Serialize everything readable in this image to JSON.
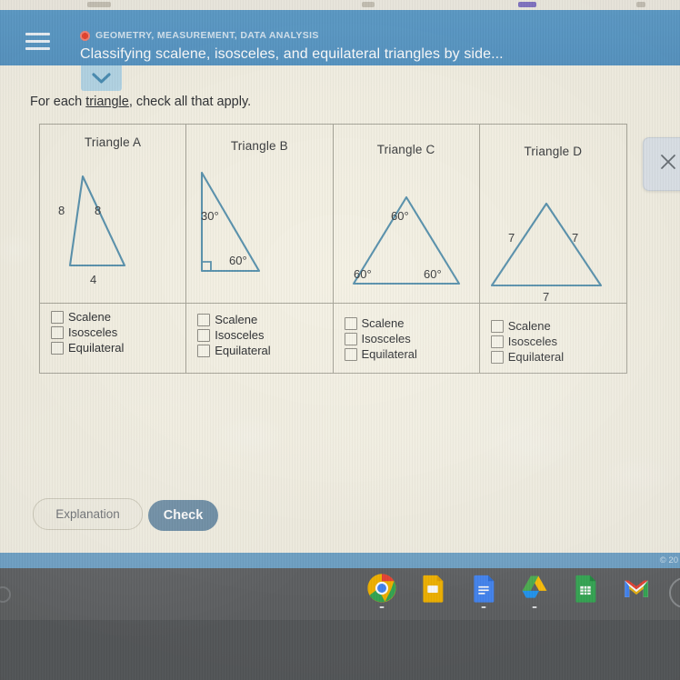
{
  "header": {
    "category": "GEOMETRY, MEASUREMENT, DATA ANALYSIS",
    "title": "Classifying scalene, isosceles, and equilateral triangles by side...",
    "menu_icon": "hamburger-icon",
    "category_icon": "red-circle-icon",
    "accent_color": "#5795c3"
  },
  "instructions": {
    "before": "For each ",
    "link": "triangle",
    "after": ", check all that apply."
  },
  "expander": {
    "icon": "chevron-down-icon"
  },
  "close_panel": {
    "icon": "close-icon",
    "label": "×"
  },
  "options": [
    "Scalene",
    "Isosceles",
    "Equilateral"
  ],
  "triangles": [
    {
      "name": "Triangle A",
      "kind": "isosceles",
      "labels": {
        "left_side": "8",
        "right_side": "8",
        "base": "4"
      },
      "options": [
        {
          "label": "Scalene",
          "checked": false
        },
        {
          "label": "Isosceles",
          "checked": false
        },
        {
          "label": "Equilateral",
          "checked": false
        }
      ]
    },
    {
      "name": "Triangle B",
      "kind": "right-scalene",
      "labels": {
        "top_angle": "30°",
        "bottom_angle": "60°",
        "right_angle_marker": true
      },
      "options": [
        {
          "label": "Scalene",
          "checked": false
        },
        {
          "label": "Isosceles",
          "checked": false
        },
        {
          "label": "Equilateral",
          "checked": false
        }
      ]
    },
    {
      "name": "Triangle C",
      "kind": "equiangular",
      "labels": {
        "apex_angle": "60°",
        "left_angle": "60°",
        "right_angle": "60°"
      },
      "options": [
        {
          "label": "Scalene",
          "checked": false
        },
        {
          "label": "Isosceles",
          "checked": false
        },
        {
          "label": "Equilateral",
          "checked": false
        }
      ]
    },
    {
      "name": "Triangle D",
      "kind": "equilateral",
      "labels": {
        "left_side": "7",
        "right_side": "7",
        "base": "7"
      },
      "options": [
        {
          "label": "Scalene",
          "checked": false
        },
        {
          "label": "Isosceles",
          "checked": false
        },
        {
          "label": "Equilateral",
          "checked": false
        }
      ]
    }
  ],
  "footer": {
    "explanation_label": "Explanation",
    "check_label": "Check",
    "copyright": "© 20"
  },
  "shelf": {
    "icons": [
      {
        "name": "chrome-icon"
      },
      {
        "name": "google-slides-icon"
      },
      {
        "name": "google-docs-icon"
      },
      {
        "name": "google-drive-icon"
      },
      {
        "name": "google-sheets-icon"
      },
      {
        "name": "gmail-icon"
      }
    ]
  },
  "colors": {
    "page_background": "#f4f1e4",
    "header_blue": "#5795c3",
    "triangle_stroke": "#5b93ae",
    "check_button": "#6d8fa6",
    "shelf": "#5f6163"
  }
}
